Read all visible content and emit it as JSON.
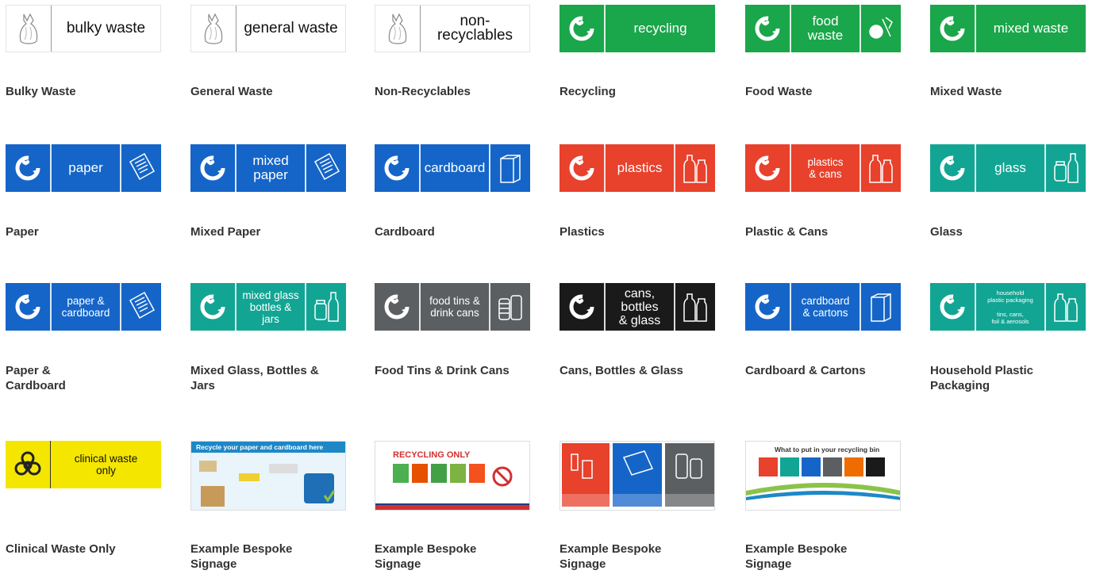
{
  "rows": [
    {
      "items": [
        {
          "caption": "Bulky Waste",
          "type": "white",
          "label": "bulky waste",
          "icon": "bag-icon"
        },
        {
          "caption": "General Waste",
          "type": "white",
          "label": "general waste",
          "icon": "bag-icon"
        },
        {
          "caption": "Non-Recyclables",
          "type": "white",
          "label": "non-recyclables",
          "icon": "bag-icon"
        },
        {
          "caption": "Recycling",
          "type": "green",
          "label": "recycling",
          "icon": "recycle-icon"
        },
        {
          "caption": "Food Waste",
          "type": "green",
          "label": "food\nwaste",
          "icon": "recycle-icon",
          "pic": "food-icon"
        },
        {
          "caption": "Mixed Waste",
          "type": "green",
          "label": "mixed waste",
          "icon": "recycle-icon"
        }
      ]
    },
    {
      "items": [
        {
          "caption": "Paper",
          "type": "blue",
          "label": "paper",
          "icon": "recycle-icon",
          "pic": "paper-icon"
        },
        {
          "caption": "Mixed Paper",
          "type": "blue",
          "label": "mixed\npaper",
          "icon": "recycle-icon",
          "pic": "paper-icon"
        },
        {
          "caption": "Cardboard",
          "type": "blue",
          "label": "cardboard",
          "icon": "recycle-icon",
          "pic": "box-icon"
        },
        {
          "caption": "Plastics",
          "type": "red",
          "label": "plastics",
          "icon": "recycle-icon",
          "pic": "bottle-icon"
        },
        {
          "caption": "Plastic & Cans",
          "type": "red",
          "label": "plastics\n& cans",
          "icon": "recycle-icon",
          "pic": "bottle-icon"
        },
        {
          "caption": "Glass",
          "type": "teal",
          "label": "glass",
          "icon": "recycle-icon",
          "pic": "jar-icon"
        }
      ]
    },
    {
      "items": [
        {
          "caption": "Paper & Cardboard",
          "type": "blue",
          "label": "paper &\ncardboard",
          "icon": "recycle-icon",
          "pic": "paper-icon"
        },
        {
          "caption": "Mixed Glass, Bottles & Jars",
          "type": "teal",
          "label": "mixed glass\nbottles & jars",
          "icon": "recycle-icon",
          "pic": "jar-icon"
        },
        {
          "caption": "Food Tins & Drink Cans",
          "type": "grey",
          "label": "food tins &\ndrink cans",
          "icon": "recycle-icon",
          "pic": "can-icon"
        },
        {
          "caption": "Cans, Bottles & Glass",
          "type": "black",
          "label": "cans,\nbottles\n& glass",
          "icon": "recycle-icon",
          "pic": "bottle-icon"
        },
        {
          "caption": "Cardboard & Cartons",
          "type": "blue",
          "label": "cardboard\n& cartons",
          "icon": "recycle-icon",
          "pic": "box-icon"
        },
        {
          "caption": "Household Plastic Packaging",
          "type": "teal",
          "label": "household\nplastic packaging\n\ntins, cans,\nfoil & aerosols",
          "icon": "recycle-icon",
          "pic": "bottle-icon",
          "small": true
        }
      ]
    },
    {
      "items": [
        {
          "caption": "Clinical Waste Only",
          "type": "yellow",
          "label": "clinical waste\nonly",
          "icon": "biohazard-icon"
        },
        {
          "caption": "Example Bespoke Signage",
          "type": "photo",
          "label": "Recycle your paper and cardboard here",
          "variant": "poster1"
        },
        {
          "caption": "Example Bespoke Signage",
          "type": "photo",
          "label": "RECYCLING ONLY",
          "variant": "poster2"
        },
        {
          "caption": "Example Bespoke Signage",
          "type": "photo",
          "label": "",
          "variant": "poster3"
        },
        {
          "caption": "Example Bespoke Signage",
          "type": "photo",
          "label": "What to put in your recycling bin",
          "variant": "poster4"
        }
      ]
    }
  ],
  "colors": {
    "green": "#1aa64a",
    "blue": "#1565c8",
    "red": "#e8412c",
    "teal": "#12a594",
    "grey": "#5c5f61",
    "black": "#1a1a1a",
    "yellow": "#f5e600"
  }
}
